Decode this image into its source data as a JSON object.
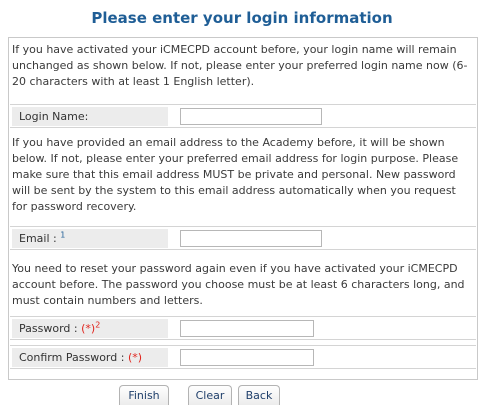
{
  "form": {
    "title": "Please enter your login information",
    "intro_text": "If you have activated your iCMECPD account before, your login name will remain unchanged as shown below. If not, please enter your preferred login name now (6-20 characters with at least 1 English letter).",
    "login_label": "Login Name:",
    "login_value": "",
    "email_text": "If you have provided an email address to the Academy before, it will be shown below. If not, please enter your preferred email address for login purpose. Please make sure that this email address MUST be private and personal. New password will be sent by the system to this email address automatically when you request for password recovery.",
    "email_label": "Email : ",
    "email_note": "1",
    "email_value": "",
    "password_text": "You need to reset your password again even if you have activated your iCMECPD account before. The password you choose must be at least 6 characters long, and must contain numbers and letters.",
    "password_label": "Password : ",
    "password_required": "(*)",
    "password_note": "2",
    "password_value": "",
    "confirm_label": "Confirm Password : ",
    "confirm_required": "(*)",
    "confirm_value": ""
  },
  "buttons": {
    "finish": "Finish",
    "clear": "Clear",
    "back": "Back"
  },
  "colors": {
    "title": "#1f5e96",
    "required": "#e0261f",
    "label_bg": "#ececec"
  }
}
